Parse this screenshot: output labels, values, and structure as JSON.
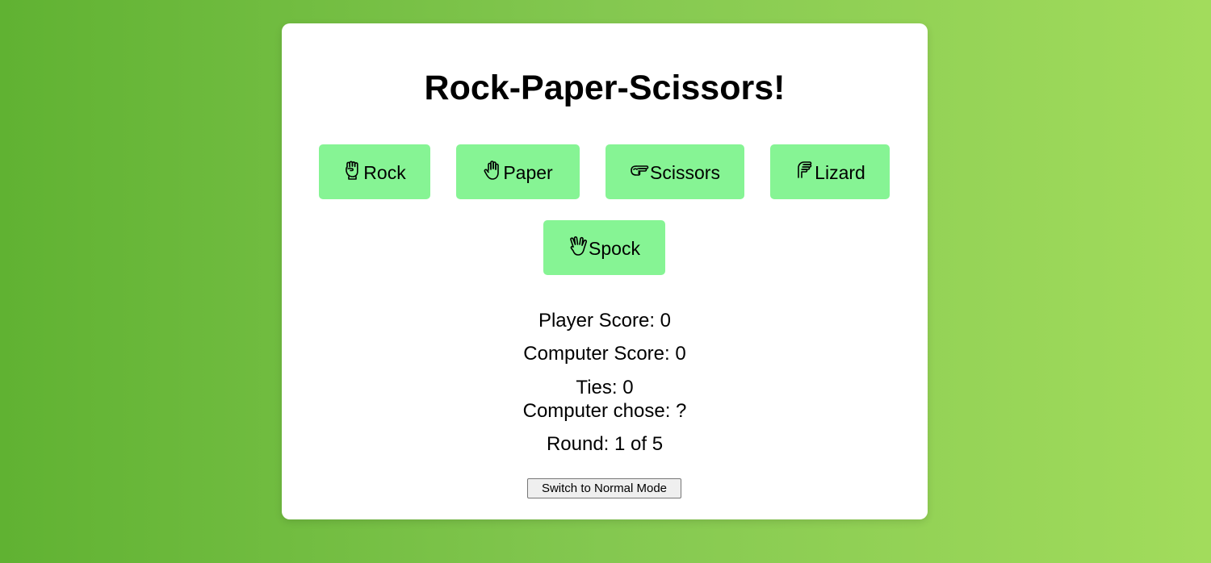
{
  "game": {
    "title": "Rock-Paper-Scissors!",
    "choices": [
      {
        "label": "Rock",
        "icon": "fist-icon"
      },
      {
        "label": "Paper",
        "icon": "raised-hand-icon"
      },
      {
        "label": "Scissors",
        "icon": "scissors-hand-icon"
      },
      {
        "label": "Lizard",
        "icon": "lizard-hand-icon"
      },
      {
        "label": "Spock",
        "icon": "vulcan-salute-icon"
      }
    ],
    "player_score": "Player Score: 0",
    "computer_score": "Computer Score: 0",
    "ties": "Ties: 0",
    "computer_chose": "Computer chose: ?",
    "round": "Round: 1 of 5",
    "mode_button_label": "Switch to Normal Mode"
  },
  "colors": {
    "background_start": "#60b232",
    "background_end": "#a2dc5c",
    "card": "#ffffff",
    "choice_button": "#86f494"
  }
}
